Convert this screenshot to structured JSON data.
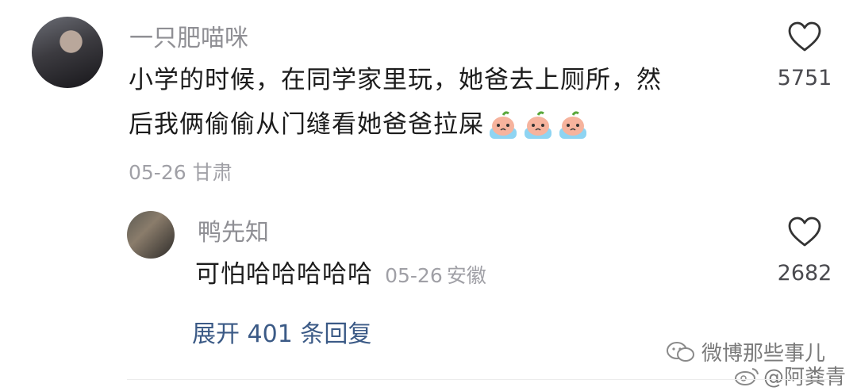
{
  "comment": {
    "username": "一只肥喵咪",
    "text_line1": "小学的时候，在同学家里玩，她爸去上厕所，然",
    "text_line2": "后我俩偷偷从门缝看她爸爸拉屎",
    "date": "05-26",
    "location": "甘肃",
    "likes": "5751",
    "emoji_count": 3
  },
  "reply": {
    "username": "鸭先知",
    "text": "可怕哈哈哈哈哈",
    "date": "05-26",
    "location": "安徽",
    "likes": "2682"
  },
  "expand_label": "展开 401 条回复",
  "watermark": {
    "line1": "微博那些事儿",
    "line2": "@阿粪青"
  },
  "colors": {
    "username": "#8f8f94",
    "meta": "#a0a0a6",
    "expand_link": "#3b5a86"
  }
}
